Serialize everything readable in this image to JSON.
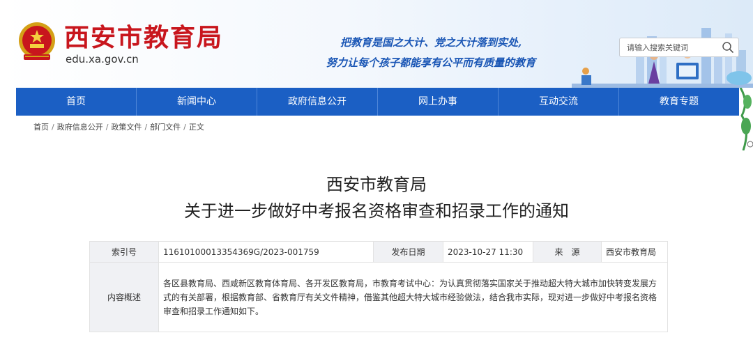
{
  "header": {
    "site_title": "西安市教育局",
    "site_domain": "edu.xa.gov.cn",
    "slogan_line1": "把教育是国之大计、党之大计落到实处,",
    "slogan_line2": "努力让每个孩子都能享有公平而有质量的教育",
    "search_placeholder": "请输入搜索关键词"
  },
  "nav": {
    "items": [
      "首页",
      "新闻中心",
      "政府信息公开",
      "网上办事",
      "互动交流",
      "教育专题"
    ]
  },
  "breadcrumb": [
    "首页",
    "政府信息公开",
    "政策文件",
    "部门文件",
    "正文"
  ],
  "article": {
    "title_line1": "西安市教育局",
    "title_line2": "关于进一步做好中考报名资格审查和招录工作的通知"
  },
  "meta": {
    "index_label": "索引号",
    "index_value": "11610100013354369G/2023-001759",
    "date_label": "发布日期",
    "date_value": "2023-10-27 11:30",
    "source_label": "来　源",
    "source_value": "西安市教育局",
    "summary_label": "内容概述",
    "summary_value": "各区县教育局、西咸新区教育体育局、各开发区教育局，市教育考试中心：为认真贯彻落实国家关于推动超大特大城市加快转变发展方式的有关部署，根据教育部、省教育厅有关文件精神，借鉴其他超大特大城市经验做法，结合我市实际，现对进一步做好中考报名资格审查和招录工作通知如下。"
  },
  "colors": {
    "brand_red": "#c8161d",
    "nav_blue": "#1b5fc4",
    "slogan_blue": "#1a56b5"
  }
}
